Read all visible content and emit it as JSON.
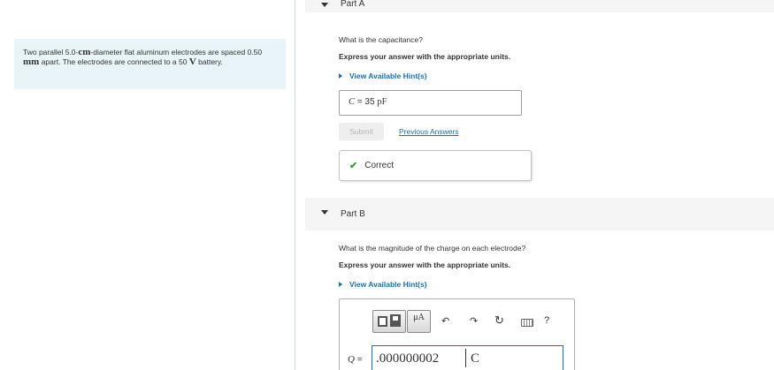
{
  "problem": {
    "text_1": "Two parallel ",
    "diameter": "5.0-",
    "diameter_unit": "cm",
    "text_2": "-diameter flat aluminum electrodes are spaced ",
    "spacing": "0.50 ",
    "spacing_unit": "mm",
    "text_3": " apart. The electrodes are connected to a ",
    "voltage": "50 ",
    "voltage_unit": "V",
    "text_4": " battery."
  },
  "part_a": {
    "title": "Part A",
    "question": "What is the capacitance?",
    "instruction": "Express your answer with the appropriate units.",
    "hint_label": "View Available Hint(s)",
    "answer_var": "C",
    "answer_eq": " = ",
    "answer_value": "35 ",
    "answer_unit": "pF",
    "submit_label": "Submit",
    "previous_answers_label": "Previous Answers",
    "status_label": "Correct"
  },
  "part_b": {
    "title": "Part B",
    "question": "What is the magnitude of the charge on each electrode?",
    "instruction": "Express your answer with the appropriate units.",
    "hint_label": "View Available Hint(s)",
    "toolbar": {
      "units_button_label": "μA",
      "help_label": "?"
    },
    "answer_var": "Q",
    "answer_eq": " =",
    "answer_value": ".000000002",
    "answer_unit": "C"
  },
  "colors": {
    "link": "#1a6fa5",
    "correct_check": "#3d9a3d",
    "problem_bg": "#e8f4f8"
  }
}
